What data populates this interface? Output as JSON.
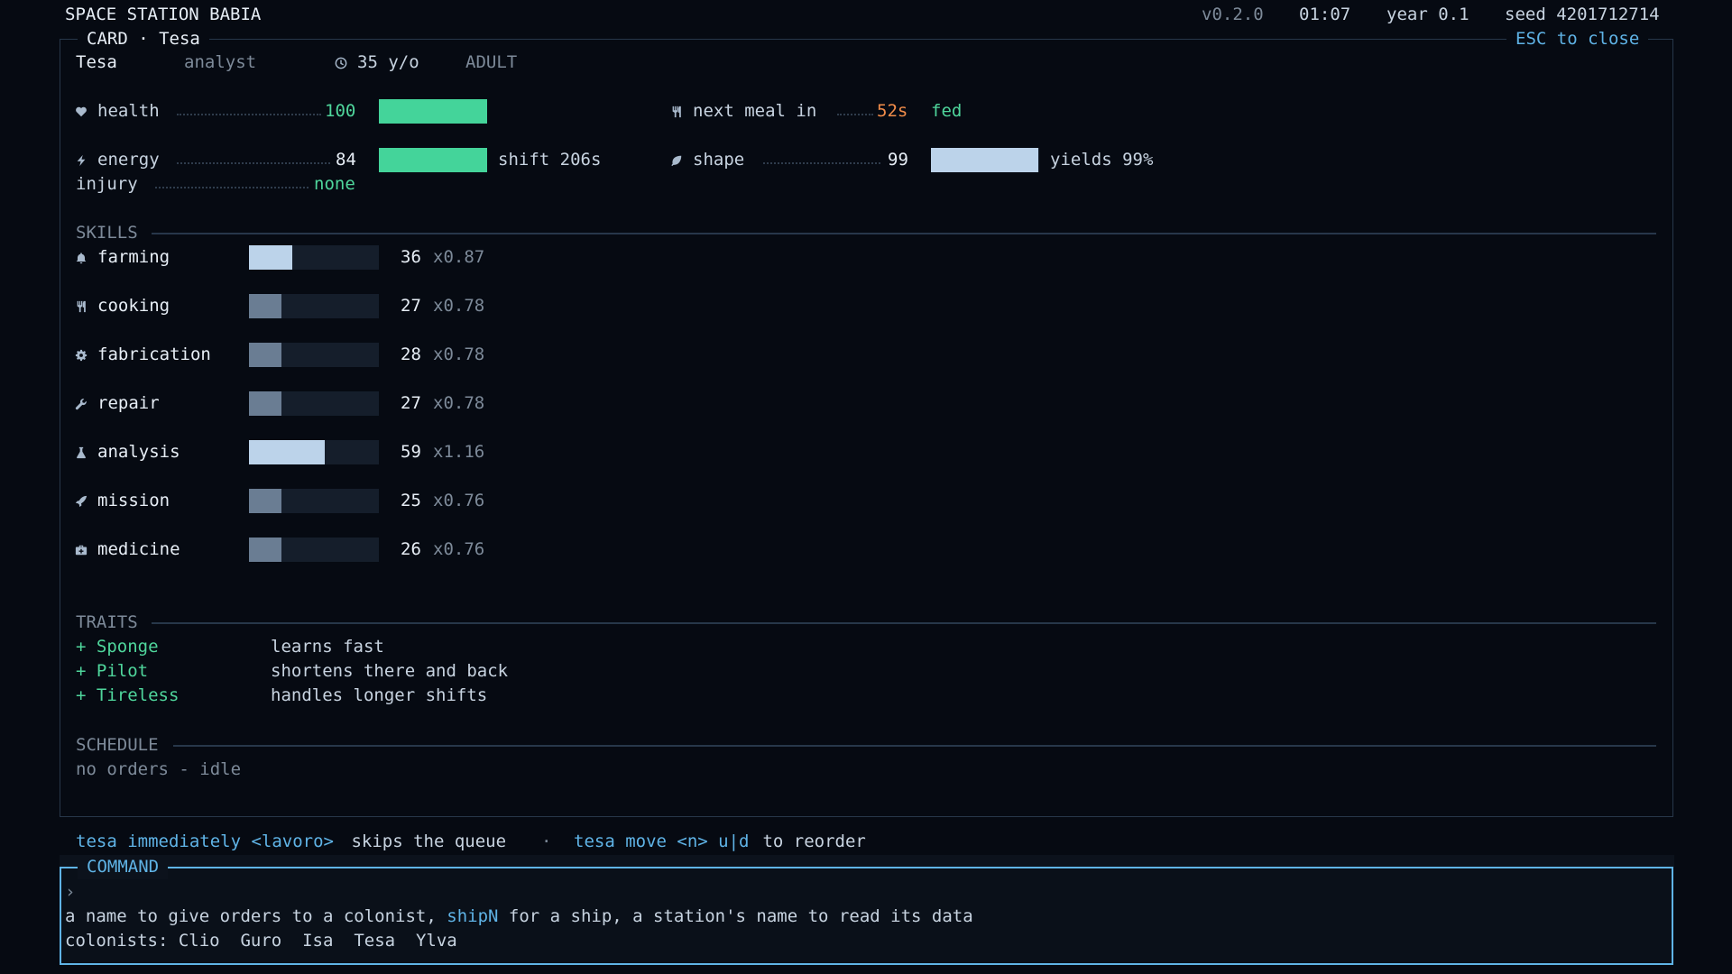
{
  "topbar": {
    "title": "SPACE STATION BABIA",
    "version": "v0.2.0",
    "clock": "01:07",
    "year": "year 0.1",
    "seed": "seed 4201712714"
  },
  "card": {
    "frame_title": "CARD · Tesa",
    "close_hint": "ESC to close",
    "name": "Tesa",
    "role": "analyst",
    "age": "35 y/o",
    "stage": "ADULT",
    "stats": {
      "health": {
        "label": "health",
        "value": "100",
        "fill": 1.0
      },
      "energy": {
        "label": "energy",
        "value": "84",
        "fill": 1.0,
        "note": "shift 206s"
      },
      "injury": {
        "label": "injury",
        "value": "none"
      },
      "meal": {
        "label": "next meal in",
        "value": "52s",
        "status": "fed"
      },
      "shape": {
        "label": "shape",
        "value": "99",
        "fill": 0.99,
        "note": "yields 99%"
      }
    },
    "skills_title": "SKILLS",
    "skills": [
      {
        "icon": "bell-icon",
        "name": "farming",
        "value": "36",
        "mult": "x0.87",
        "fill": 0.33,
        "tone": "light"
      },
      {
        "icon": "fork-knife-icon",
        "name": "cooking",
        "value": "27",
        "mult": "x0.78",
        "fill": 0.25,
        "tone": "mid"
      },
      {
        "icon": "gear-icon",
        "name": "fabrication",
        "value": "28",
        "mult": "x0.78",
        "fill": 0.25,
        "tone": "mid"
      },
      {
        "icon": "wrench-icon",
        "name": "repair",
        "value": "27",
        "mult": "x0.78",
        "fill": 0.25,
        "tone": "mid"
      },
      {
        "icon": "flask-icon",
        "name": "analysis",
        "value": "59",
        "mult": "x1.16",
        "fill": 0.58,
        "tone": "light"
      },
      {
        "icon": "rocket-icon",
        "name": "mission",
        "value": "25",
        "mult": "x0.76",
        "fill": 0.25,
        "tone": "mid"
      },
      {
        "icon": "medkit-icon",
        "name": "medicine",
        "value": "26",
        "mult": "x0.76",
        "fill": 0.25,
        "tone": "mid"
      }
    ],
    "traits_title": "TRAITS",
    "traits": [
      {
        "name": "+ Sponge",
        "desc": "learns fast"
      },
      {
        "name": "+ Pilot",
        "desc": "shortens there and back"
      },
      {
        "name": "+ Tireless",
        "desc": "handles longer shifts"
      }
    ],
    "schedule_title": "SCHEDULE",
    "schedule_text": "no orders - idle"
  },
  "hint": {
    "cmd1": "tesa immediately <lavoro>",
    "text1": " skips the queue",
    "sep": "·",
    "cmd2": "tesa move <n> u|d",
    "text2": " to reorder"
  },
  "command": {
    "title": "COMMAND",
    "prompt": "›",
    "help_pre": "a name to give orders to a colonist, ",
    "help_kw": "shipN",
    "help_post": " for a ship, a station's name to read its data",
    "colonists_label": "colonists:",
    "colonists": [
      "Clio",
      "Guro",
      "Isa",
      "Tesa",
      "Ylva"
    ]
  },
  "colors": {
    "accent": "#5fb3e6",
    "good": "#4fd69c",
    "warn": "#f28d4a"
  }
}
